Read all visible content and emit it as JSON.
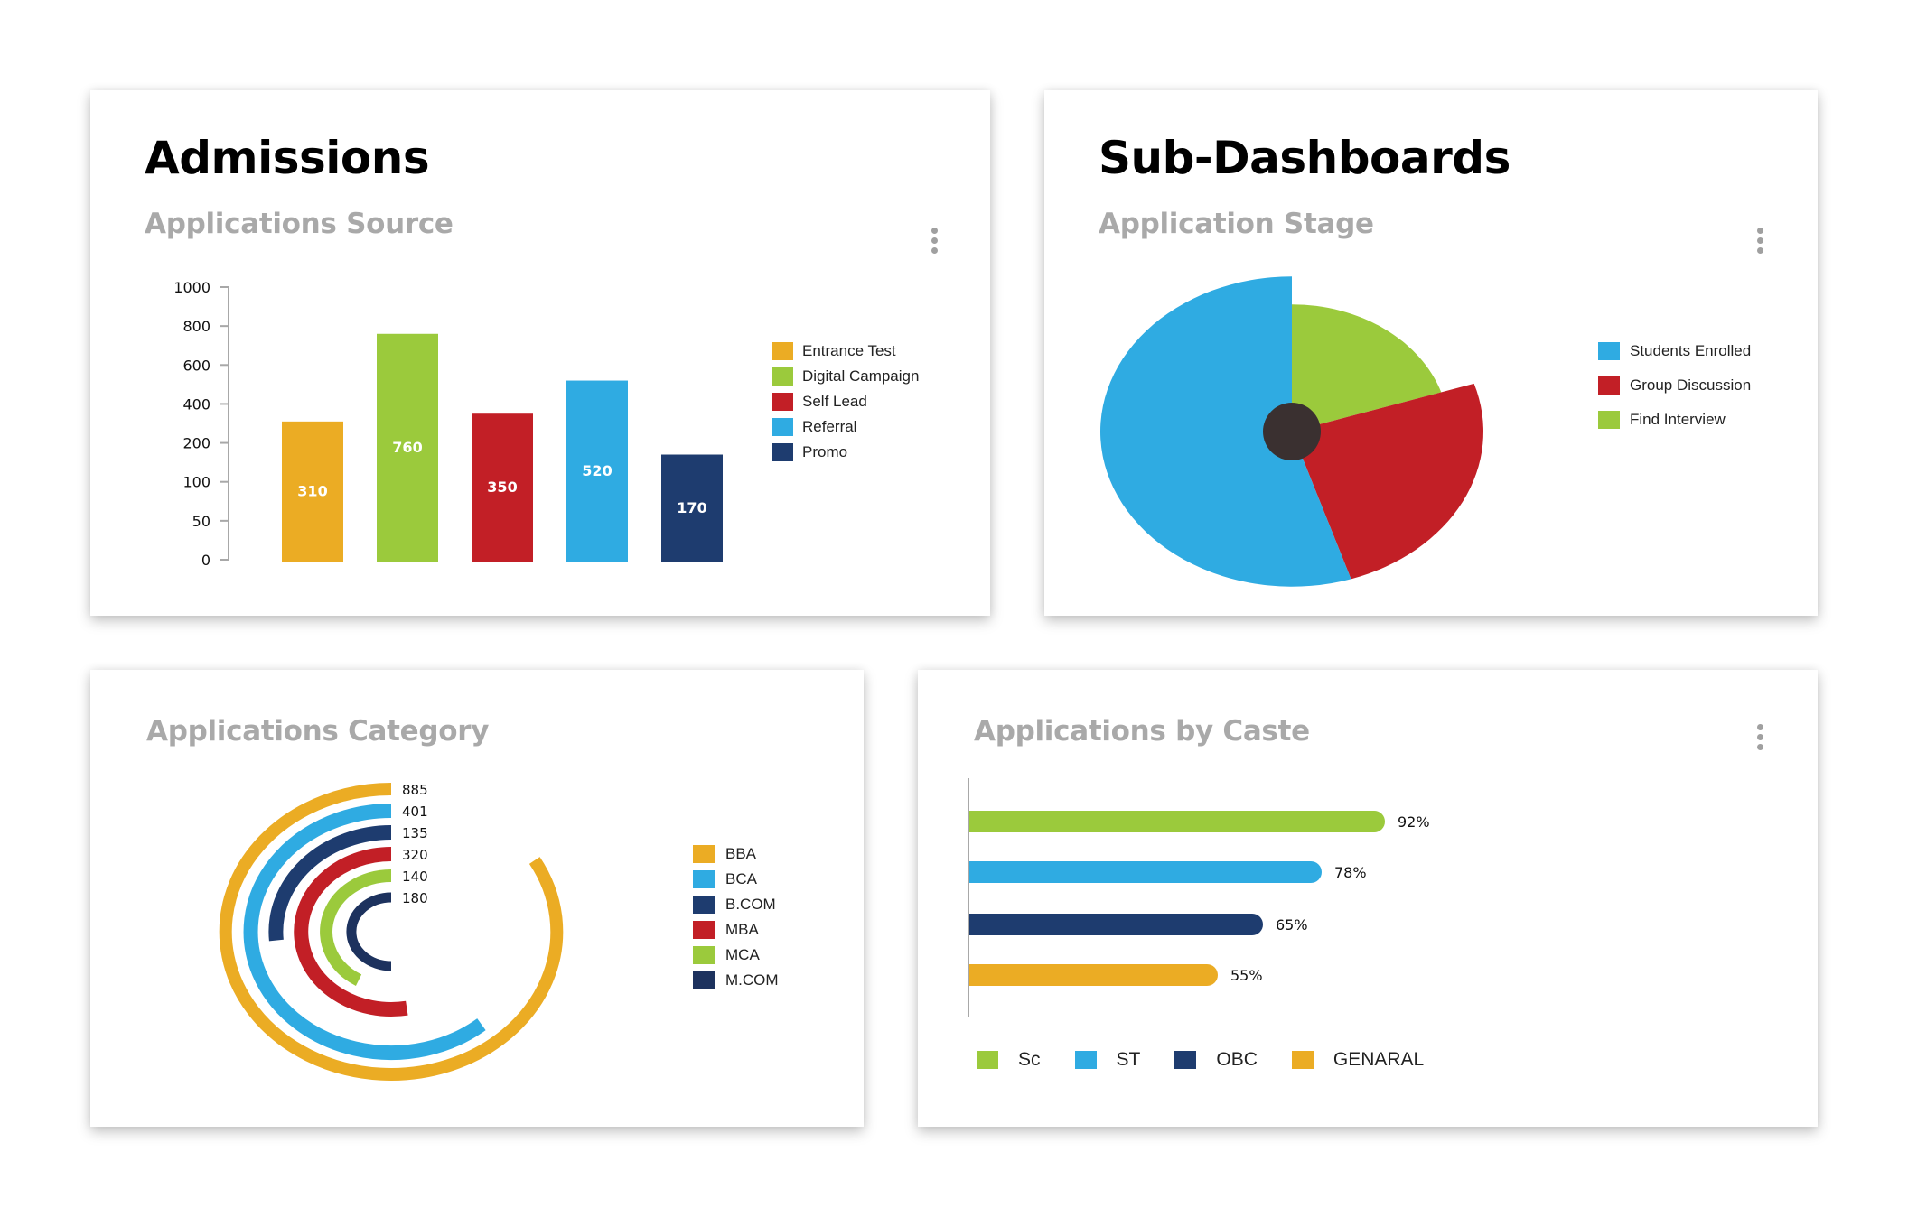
{
  "colors": {
    "yellow": "#ebac24",
    "green": "#9bca3c",
    "red": "#c21f26",
    "blue": "#2fabe2",
    "navy": "#1e3c6f",
    "dark_navy": "#1d325e",
    "hub": "#3a3030",
    "axis": "#a8a8a8",
    "title": "#000000",
    "subtitle": "#a9a9a9"
  },
  "admissions": {
    "page_title": "Admissions",
    "section_title": "Applications Source",
    "menu_icon": "kebab-menu-icon"
  },
  "subdashboards": {
    "page_title": "Sub-Dashboards",
    "section_title": "Application Stage",
    "menu_icon": "kebab-menu-icon"
  },
  "category": {
    "section_title": "Applications Category"
  },
  "caste": {
    "section_title": "Applications by Caste",
    "menu_icon": "kebab-menu-icon"
  },
  "chart_data": [
    {
      "id": "applications-source",
      "type": "bar",
      "title": "Applications Source",
      "xlabel": "",
      "ylabel": "",
      "yticks": [
        0,
        50,
        100,
        200,
        400,
        600,
        800,
        1000
      ],
      "ylim": [
        0,
        1000
      ],
      "y_scale": "tick-spaced (non-linear)",
      "grid": false,
      "legend_position": "right",
      "categories": [
        "Entrance Test",
        "Digital Campaign",
        "Self Lead",
        "Referral",
        "Promo"
      ],
      "values": [
        310,
        760,
        350,
        520,
        170
      ],
      "colors": [
        "#ebac24",
        "#9bca3c",
        "#c21f26",
        "#2fabe2",
        "#1e3c6f"
      ],
      "data_labels": [
        "310",
        "760",
        "350",
        "520",
        "170"
      ]
    },
    {
      "id": "application-stage",
      "type": "pie",
      "title": "Application Stage",
      "legend_position": "right",
      "slices": [
        {
          "label": "Find Interview",
          "fraction": 0.2,
          "radius_scale": 0.82,
          "color": "#9bca3c"
        },
        {
          "label": "Group Discussion",
          "fraction": 0.25,
          "radius_scale": 1.0,
          "color": "#c21f26"
        },
        {
          "label": "Students Enrolled",
          "fraction": 0.55,
          "radius_scale": 1.0,
          "color": "#2fabe2"
        }
      ],
      "legend": [
        "Students Enrolled",
        "Group Discussion",
        "Find Interview"
      ],
      "legend_colors": [
        "#2fabe2",
        "#c21f26",
        "#9bca3c"
      ]
    },
    {
      "id": "applications-category",
      "type": "radial-bar",
      "title": "Applications Category",
      "legend_position": "right",
      "series": [
        {
          "name": "BBA",
          "value": 885,
          "color": "#ebac24"
        },
        {
          "name": "BCA",
          "value": 401,
          "color": "#2fabe2"
        },
        {
          "name": "B.COM",
          "value": 135,
          "color": "#1e3c6f"
        },
        {
          "name": "MBA",
          "value": 320,
          "color": "#c21f26"
        },
        {
          "name": "MCA",
          "value": 140,
          "color": "#9bca3c"
        },
        {
          "name": "M.COM",
          "value": 180,
          "color": "#1d325e"
        }
      ],
      "arc_sweep_degrees": [
        300,
        220,
        95,
        190,
        150,
        180
      ],
      "labels": [
        "885",
        "401",
        "135",
        "320",
        "140",
        "180"
      ]
    },
    {
      "id": "applications-by-caste",
      "type": "bar",
      "orientation": "horizontal",
      "title": "Applications by Caste",
      "xlim": [
        0,
        100
      ],
      "unit": "%",
      "legend_position": "bottom",
      "categories": [
        "Sc",
        "ST",
        "OBC",
        "GENARAL"
      ],
      "values": [
        92,
        78,
        65,
        55
      ],
      "colors": [
        "#9bca3c",
        "#2fabe2",
        "#1e3c6f",
        "#ebac24"
      ],
      "data_labels": [
        "92%",
        "78%",
        "65%",
        "55%"
      ]
    }
  ]
}
